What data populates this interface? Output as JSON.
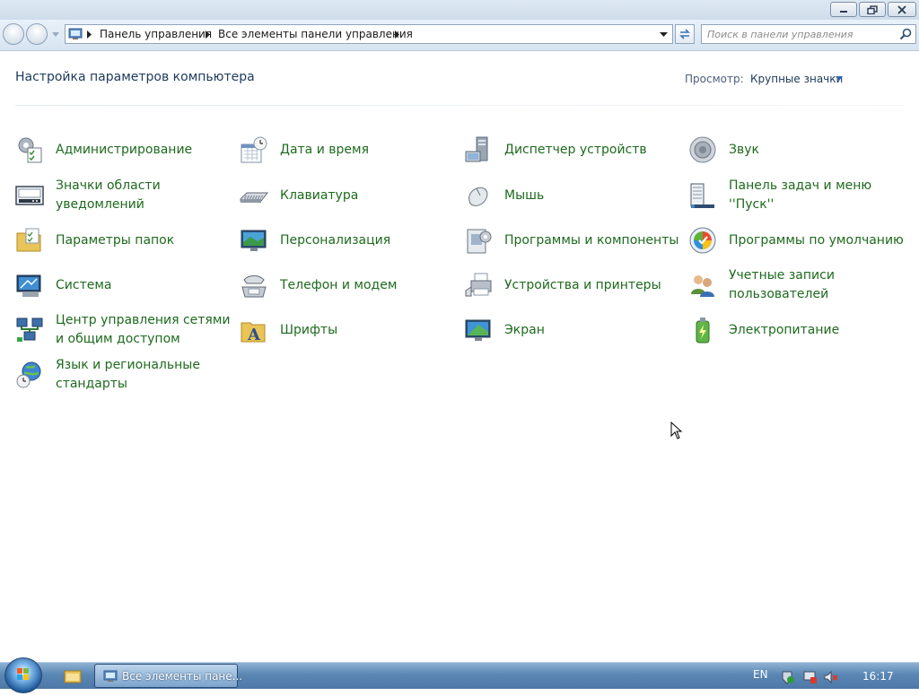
{
  "address": {
    "crumbs": [
      "Панель управления",
      "Все элементы панели управления"
    ]
  },
  "search": {
    "placeholder": "Поиск в панели управления"
  },
  "header": {
    "title": "Настройка параметров компьютера",
    "view_label": "Просмотр:",
    "view_value": "Крупные значки"
  },
  "items": [
    {
      "label": "Администрирование",
      "icon": "admin-tools-icon"
    },
    {
      "label": "Дата и время",
      "icon": "date-time-icon"
    },
    {
      "label": "Диспетчер устройств",
      "icon": "device-manager-icon"
    },
    {
      "label": "Звук",
      "icon": "sound-icon"
    },
    {
      "label": "Значки области уведомлений",
      "icon": "notification-icons-icon"
    },
    {
      "label": "Клавиатура",
      "icon": "keyboard-icon"
    },
    {
      "label": "Мышь",
      "icon": "mouse-icon"
    },
    {
      "label": "Панель задач и меню ''Пуск''",
      "icon": "taskbar-start-menu-icon"
    },
    {
      "label": "Параметры папок",
      "icon": "folder-options-icon"
    },
    {
      "label": "Персонализация",
      "icon": "personalization-icon"
    },
    {
      "label": "Программы и компоненты",
      "icon": "programs-features-icon"
    },
    {
      "label": "Программы по умолчанию",
      "icon": "default-programs-icon"
    },
    {
      "label": "Система",
      "icon": "system-icon"
    },
    {
      "label": "Телефон и модем",
      "icon": "phone-modem-icon"
    },
    {
      "label": "Устройства и принтеры",
      "icon": "devices-printers-icon"
    },
    {
      "label": "Учетные записи пользователей",
      "icon": "user-accounts-icon"
    },
    {
      "label": "Центр управления сетями и общим доступом",
      "icon": "network-center-icon"
    },
    {
      "label": "Шрифты",
      "icon": "fonts-icon"
    },
    {
      "label": "Экран",
      "icon": "display-icon"
    },
    {
      "label": "Электропитание",
      "icon": "power-options-icon"
    },
    {
      "label": "Язык и региональные стандарты",
      "icon": "region-language-icon"
    }
  ],
  "taskbar": {
    "window_button": "Все элементы пане...",
    "language": "EN",
    "clock": "16:17"
  }
}
